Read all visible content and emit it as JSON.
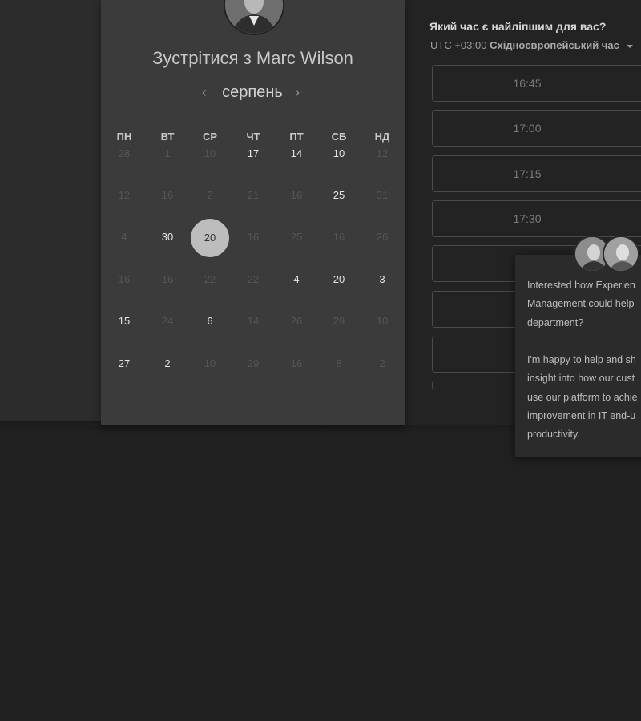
{
  "calendar": {
    "meet_title": "Зустрітися з Marc Wilson",
    "month": "серпень",
    "prev_icon": "‹",
    "next_icon": "›",
    "weekdays": [
      "ПН",
      "ВТ",
      "СР",
      "ЧТ",
      "ПТ",
      "СБ",
      "НД"
    ],
    "weeks": [
      [
        {
          "d": "28",
          "a": false
        },
        {
          "d": "1",
          "a": false
        },
        {
          "d": "10",
          "a": false
        },
        {
          "d": "17",
          "a": true
        },
        {
          "d": "14",
          "a": true
        },
        {
          "d": "10",
          "a": true
        },
        {
          "d": "12",
          "a": false
        }
      ],
      [
        {
          "d": "12",
          "a": false
        },
        {
          "d": "16",
          "a": false
        },
        {
          "d": "2",
          "a": false
        },
        {
          "d": "21",
          "a": false
        },
        {
          "d": "16",
          "a": false
        },
        {
          "d": "25",
          "a": true
        },
        {
          "d": "31",
          "a": false
        }
      ],
      [
        {
          "d": "4",
          "a": false
        },
        {
          "d": "30",
          "a": true
        },
        {
          "d": "20",
          "a": true,
          "s": true
        },
        {
          "d": "16",
          "a": false
        },
        {
          "d": "25",
          "a": false
        },
        {
          "d": "16",
          "a": false
        },
        {
          "d": "26",
          "a": false
        }
      ],
      [
        {
          "d": "16",
          "a": false
        },
        {
          "d": "16",
          "a": false
        },
        {
          "d": "22",
          "a": false
        },
        {
          "d": "22",
          "a": false
        },
        {
          "d": "4",
          "a": true
        },
        {
          "d": "20",
          "a": true
        },
        {
          "d": "3",
          "a": true
        }
      ],
      [
        {
          "d": "15",
          "a": true
        },
        {
          "d": "24",
          "a": false
        },
        {
          "d": "6",
          "a": true
        },
        {
          "d": "14",
          "a": false
        },
        {
          "d": "26",
          "a": false
        },
        {
          "d": "29",
          "a": false
        },
        {
          "d": "10",
          "a": false
        }
      ],
      [
        {
          "d": "27",
          "a": true
        },
        {
          "d": "2",
          "a": true
        },
        {
          "d": "10",
          "a": false
        },
        {
          "d": "29",
          "a": false
        },
        {
          "d": "16",
          "a": false
        },
        {
          "d": "8",
          "a": false
        },
        {
          "d": "2",
          "a": false
        }
      ]
    ]
  },
  "timezone": {
    "question": "Який час є найліпшим для вас?",
    "offset": "UTC +03:00",
    "name": "Східноєвропейський час"
  },
  "slots": [
    "16:45",
    "17:00",
    "17:15",
    "17:30",
    "",
    "",
    "",
    ""
  ],
  "chat": {
    "lines_1": [
      "Interested how Experien",
      "Management could help",
      "department?"
    ],
    "lines_2": [
      "I'm happy to help and sh",
      "insight into how our cust",
      "use our platform to achie",
      "improvement in IT end-u",
      "productivity."
    ]
  },
  "colors": {
    "selected_day_bg": "#bdbdbd",
    "card_bg": "#3b3b3b",
    "page_bg": "#212121"
  }
}
